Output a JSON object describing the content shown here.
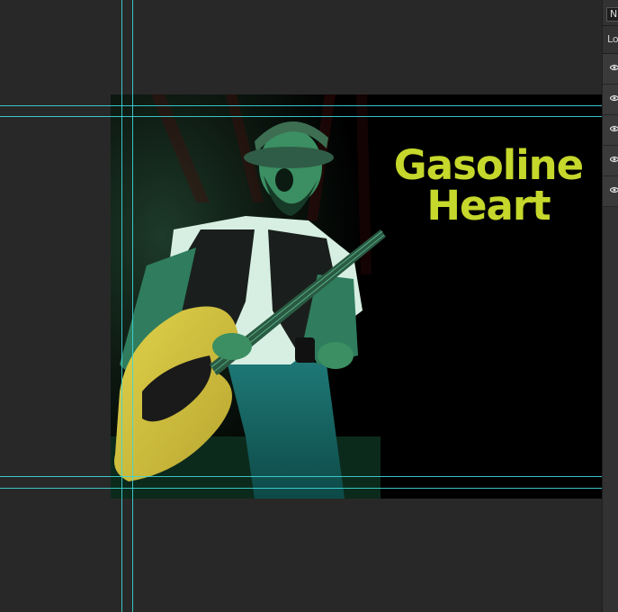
{
  "artwork": {
    "title_line1": "Gasoline",
    "title_line2": "Heart",
    "title_color": "#c5d82b",
    "background_color": "#000000",
    "photo_description_icon": "guitarist-photo"
  },
  "layers_panel": {
    "mode_label": "N",
    "lock_label": "Lo",
    "layers": [
      {
        "visibility_icon": "eye-icon"
      },
      {
        "visibility_icon": "eye-icon"
      },
      {
        "visibility_icon": "eye-icon"
      },
      {
        "visibility_icon": "eye-icon"
      },
      {
        "visibility_icon": "eye-icon"
      }
    ]
  },
  "colors": {
    "canvas_bg": "#282828",
    "guide": "#3fd6d6",
    "panel_bg": "#323232"
  }
}
